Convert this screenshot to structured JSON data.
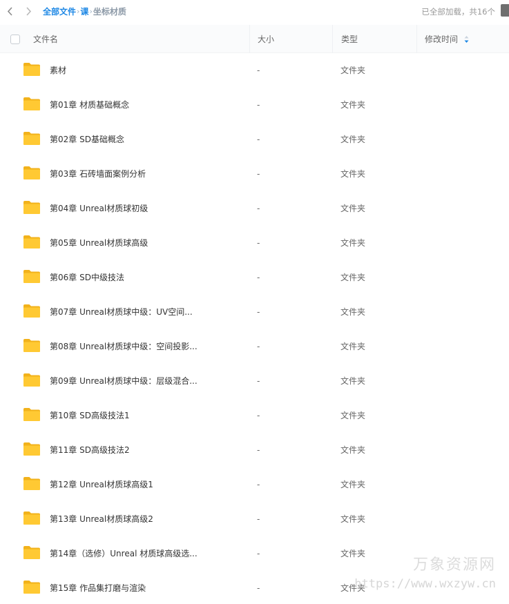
{
  "toolbar": {
    "breadcrumb": {
      "root": "全部文件",
      "level1": "课",
      "current": "坐标材质",
      "separator": "›"
    },
    "load_status": "已全部加载，共16个"
  },
  "table": {
    "headers": {
      "name": "文件名",
      "size": "大小",
      "type": "类型",
      "mtime": "修改时间"
    },
    "rows": [
      {
        "name": "素材",
        "size": "-",
        "type": "文件夹"
      },
      {
        "name": "第01章 材质基础概念",
        "size": "-",
        "type": "文件夹"
      },
      {
        "name": "第02章 SD基础概念",
        "size": "-",
        "type": "文件夹"
      },
      {
        "name": "第03章 石砖墙面案例分析",
        "size": "-",
        "type": "文件夹"
      },
      {
        "name": "第04章 Unreal材质球初级",
        "size": "-",
        "type": "文件夹"
      },
      {
        "name": "第05章 Unreal材质球高级",
        "size": "-",
        "type": "文件夹"
      },
      {
        "name": "第06章 SD中级技法",
        "size": "-",
        "type": "文件夹"
      },
      {
        "name": "第07章 Unreal材质球中级：UV空间...",
        "size": "-",
        "type": "文件夹"
      },
      {
        "name": "第08章 Unreal材质球中级：空间投影...",
        "size": "-",
        "type": "文件夹"
      },
      {
        "name": "第09章 Unreal材质球中级：层级混合...",
        "size": "-",
        "type": "文件夹"
      },
      {
        "name": "第10章 SD高级技法1",
        "size": "-",
        "type": "文件夹"
      },
      {
        "name": "第11章 SD高级技法2",
        "size": "-",
        "type": "文件夹"
      },
      {
        "name": "第12章 Unreal材质球高级1",
        "size": "-",
        "type": "文件夹"
      },
      {
        "name": "第13章 Unreal材质球高级2",
        "size": "-",
        "type": "文件夹"
      },
      {
        "name": "第14章（选修）Unreal 材质球高级选...",
        "size": "-",
        "type": "文件夹"
      },
      {
        "name": "第15章 作品集打磨与渲染",
        "size": "-",
        "type": "文件夹"
      }
    ]
  },
  "watermark": {
    "title": "万象资源网",
    "url": "https://www.wxzyw.cn"
  },
  "colors": {
    "accent": "#1e88e5",
    "folder_yellow": "#ffc933",
    "folder_tab": "#f2b21b",
    "text": "#333333",
    "muted": "#999999"
  },
  "icons": {
    "back": "chevron-left-icon",
    "forward": "chevron-right-icon",
    "sort": "sort-icon",
    "folder": "folder-icon"
  }
}
